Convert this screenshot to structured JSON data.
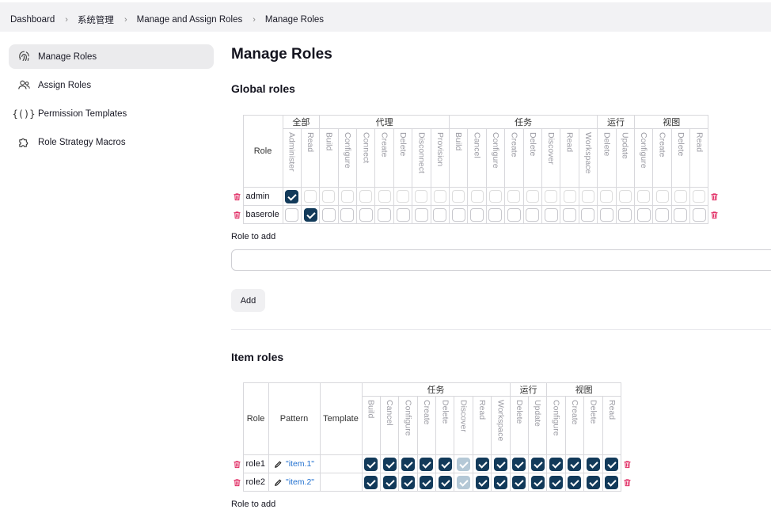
{
  "breadcrumb": [
    "Dashboard",
    "系统管理",
    "Manage and Assign Roles",
    "Manage Roles"
  ],
  "sidebar": {
    "items": [
      {
        "label": "Manage Roles",
        "icon": "fingerprint-icon",
        "active": true
      },
      {
        "label": "Assign Roles",
        "icon": "users-icon",
        "active": false
      },
      {
        "label": "Permission Templates",
        "icon": "braces-icon",
        "active": false
      },
      {
        "label": "Role Strategy Macros",
        "icon": "puzzle-icon",
        "active": false
      }
    ]
  },
  "page_title": "Manage Roles",
  "global_roles": {
    "title": "Global roles",
    "role_header": "Role",
    "groups": [
      {
        "label": "全部",
        "perms": [
          "Administer",
          "Read"
        ]
      },
      {
        "label": "代理",
        "perms": [
          "Build",
          "Configure",
          "Connect",
          "Create",
          "Delete",
          "Disconnect",
          "Provision"
        ]
      },
      {
        "label": "任务",
        "perms": [
          "Build",
          "Cancel",
          "Configure",
          "Create",
          "Delete",
          "Discover",
          "Read",
          "Workspace"
        ]
      },
      {
        "label": "运行",
        "perms": [
          "Delete",
          "Update"
        ]
      },
      {
        "label": "视图",
        "perms": [
          "Configure",
          "Create",
          "Delete",
          "Read"
        ]
      }
    ],
    "rows": [
      {
        "name": "admin",
        "checked": [
          0
        ],
        "style": "light"
      },
      {
        "name": "baserole",
        "checked": [
          1
        ],
        "style": "normal"
      }
    ]
  },
  "role_to_add_label": "Role to add",
  "role_to_add_value": "",
  "add_button_label": "Add",
  "item_roles": {
    "title": "Item roles",
    "role_header": "Role",
    "pattern_header": "Pattern",
    "template_header": "Template",
    "groups": [
      {
        "label": "任务",
        "perms": [
          "Build",
          "Cancel",
          "Configure",
          "Create",
          "Delete",
          "Discover",
          "Read",
          "Workspace"
        ]
      },
      {
        "label": "运行",
        "perms": [
          "Delete",
          "Update"
        ]
      },
      {
        "label": "视图",
        "perms": [
          "Configure",
          "Create",
          "Delete",
          "Read"
        ]
      }
    ],
    "rows": [
      {
        "name": "role1",
        "pattern": "\"item.1\"",
        "template": "",
        "disabled": [
          5
        ]
      },
      {
        "name": "role2",
        "pattern": "\"item.2\"",
        "template": "",
        "disabled": [
          5
        ]
      }
    ]
  },
  "item_role_to_add_label": "Role to add",
  "colors": {
    "accent": "#123a5a",
    "danger": "#e0245e",
    "link": "#1f6fcf"
  }
}
